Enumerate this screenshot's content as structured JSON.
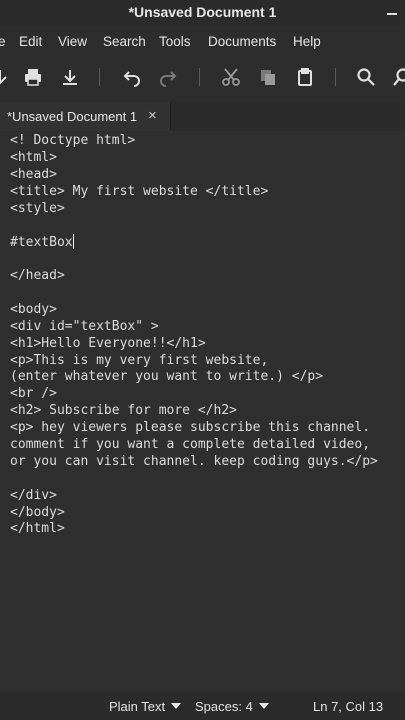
{
  "window": {
    "title": "*Unsaved Document 1"
  },
  "menu": [
    "e",
    "Edit",
    "View",
    "Search",
    "Tools",
    "Documents",
    "Help"
  ],
  "toolbar": {
    "icons": [
      "save-icon",
      "print-icon",
      "download-icon",
      "undo-icon",
      "redo-icon",
      "cut-icon",
      "copy-icon",
      "paste-icon",
      "search-icon",
      "replace-icon"
    ]
  },
  "tab": {
    "label": "*Unsaved Document 1",
    "close": "×"
  },
  "editor": {
    "lines": [
      "<! Doctype html>",
      "<html>",
      "<head>",
      "<title> My first website </title>",
      "<style>",
      "",
      "#textBox",
      "",
      "</head>",
      "",
      "<body>",
      "<div id=\"textBox\" >",
      "<h1>Hello Everyone!!</h1>",
      "<p>This is my very first website,",
      "(enter whatever you want to write.) </p>",
      "<br />",
      "<h2> Subscribe for more </h2>",
      "<p> hey viewers please subscribe this channel.",
      "comment if you want a complete detailed video,",
      "or you can visit channel. keep coding guys.</p>",
      "",
      "</div>",
      "</body>",
      "</html>"
    ]
  },
  "status": {
    "language": "Plain Text",
    "spaces": "Spaces: 4",
    "position": "Ln 7, Col 13"
  }
}
